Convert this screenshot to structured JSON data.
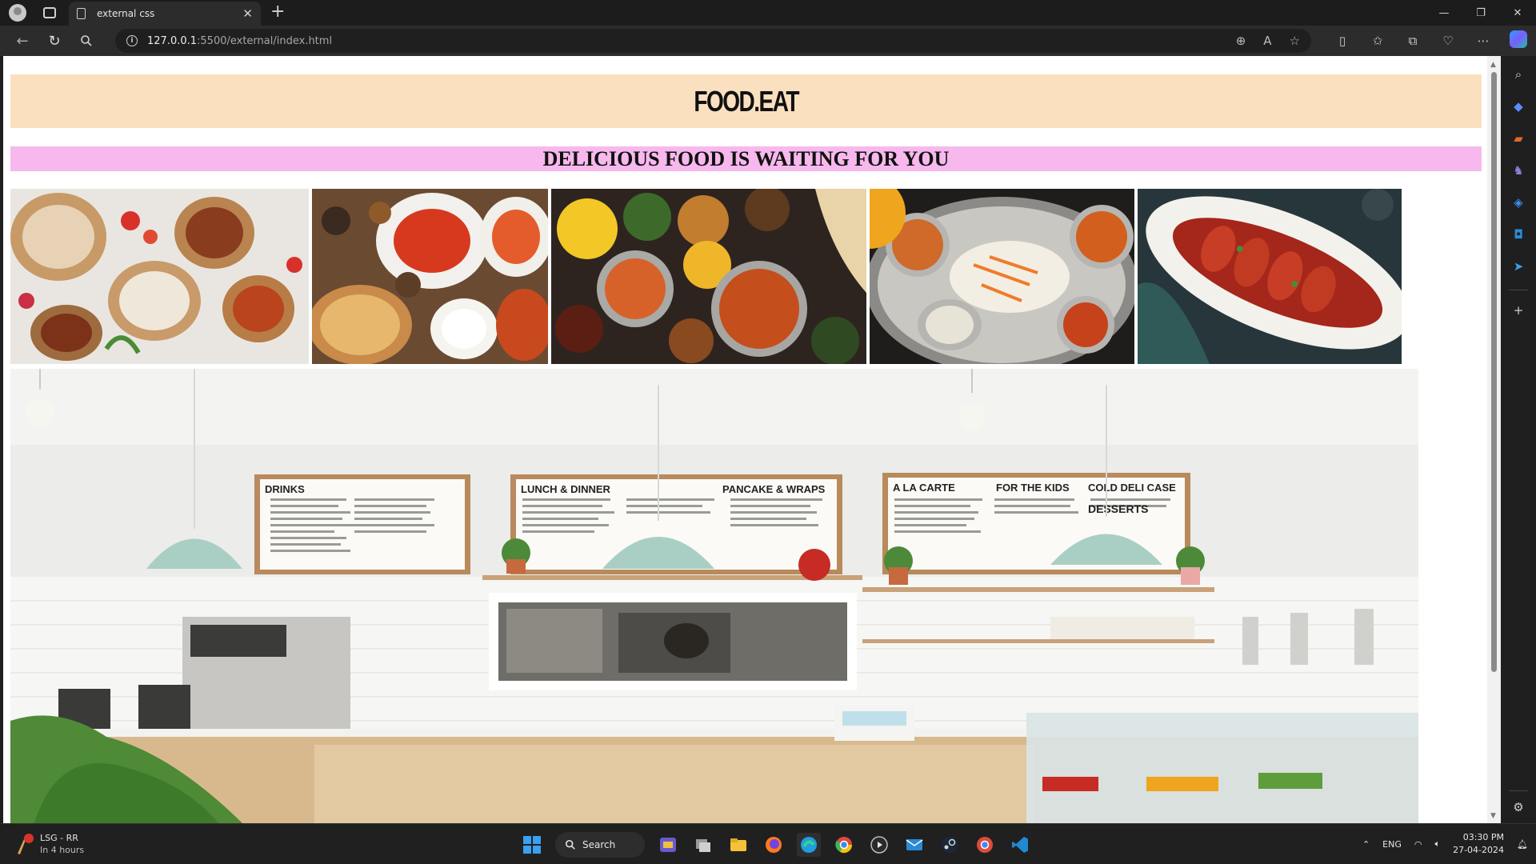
{
  "browser": {
    "tab_title": "external css",
    "tab_close": "✕",
    "new_tab": "+",
    "url_host": "127.0.0.1",
    "url_path": ":5500/external/index.html",
    "window_controls": [
      "—",
      "❐",
      "✕"
    ]
  },
  "page": {
    "logo": "FOOD.EAT",
    "tagline": "DELICIOUS FOOD IS WAITING FOR YOU",
    "colors": {
      "header_bg": "#fbe0bf",
      "tagline_bg": "#f7b8ee"
    }
  },
  "hero": {
    "menu_boards": [
      {
        "title": "DRINKS"
      },
      {
        "title": "LUNCH & DINNER"
      },
      {
        "title": "PANCAKE & WRAPS"
      },
      {
        "title": "A LA CARTE"
      },
      {
        "title": "FOR THE KIDS"
      },
      {
        "title": "COLD DELI CASE"
      },
      {
        "title": "DESSERTS"
      }
    ]
  },
  "taskbar": {
    "weather_title": "LSG - RR",
    "weather_sub": "In 4 hours",
    "weather_badge": "1",
    "search_label": "Search",
    "lang": "ENG",
    "time": "03:30 PM",
    "date": "27-04-2024"
  }
}
